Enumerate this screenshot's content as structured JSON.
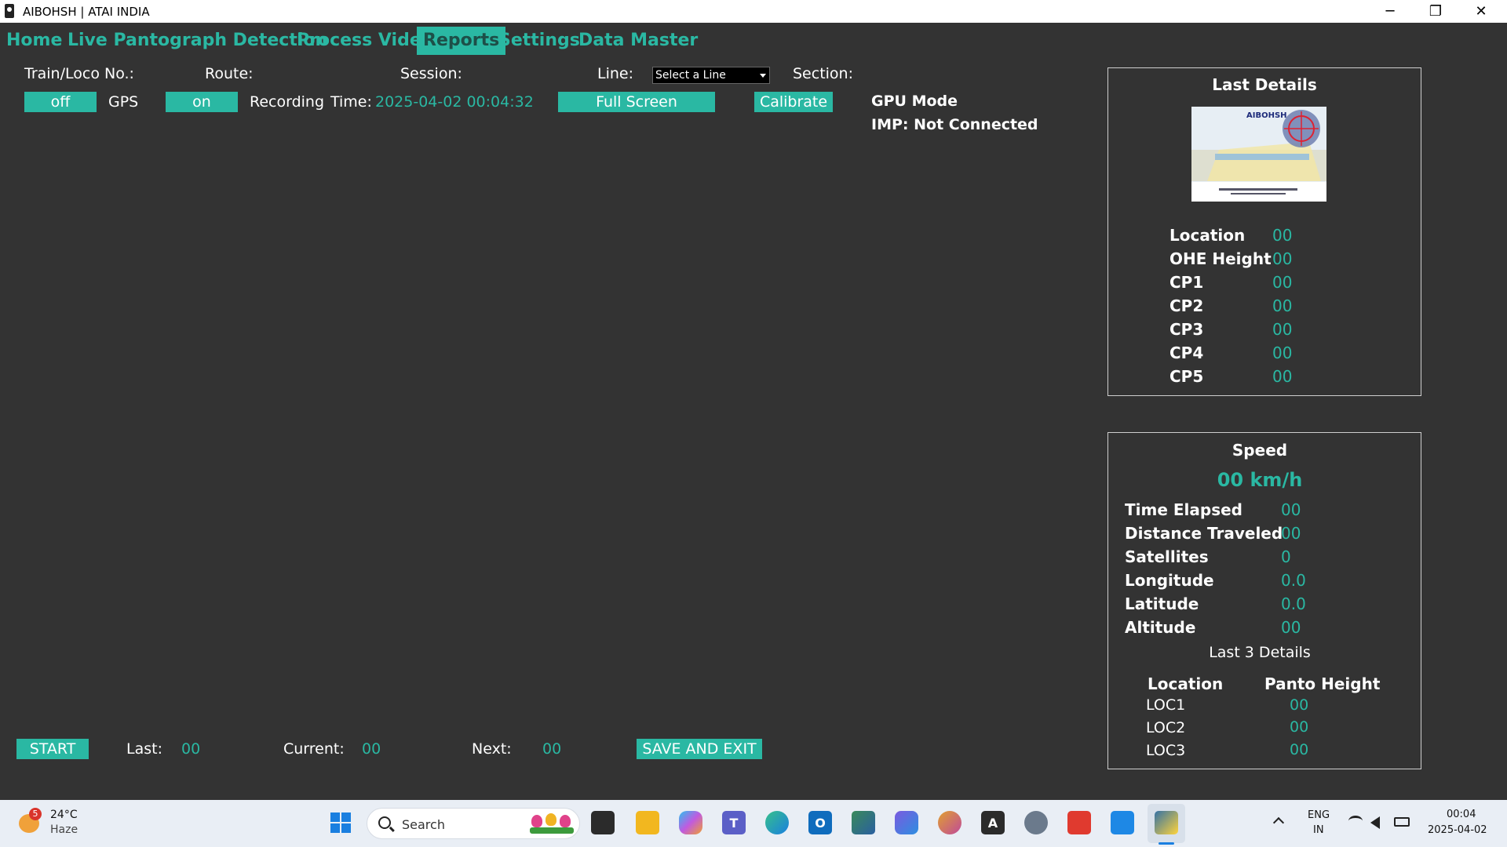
{
  "window": {
    "title": "AIBOHSH | ATAI INDIA",
    "controls": {
      "minimize": "─",
      "maximize": "❐",
      "close": "✕"
    }
  },
  "menu": {
    "items": [
      {
        "label": "Home",
        "active": false
      },
      {
        "label": "Live Pantograph Detection",
        "active": false
      },
      {
        "label": "Process Video",
        "active": false
      },
      {
        "label": "Reports",
        "active": true
      },
      {
        "label": "Settings",
        "active": false
      },
      {
        "label": "Data Master",
        "active": false
      }
    ]
  },
  "form": {
    "train_loco_label": "Train/Loco No.:",
    "route_label": "Route:",
    "session_label": "Session:",
    "line_label": "Line:",
    "line_select_value": "Select a Line",
    "section_label": "Section:"
  },
  "controls": {
    "gps_toggle": "off",
    "gps_label": "GPS",
    "recording_toggle": "on",
    "recording_label": "Recording",
    "time_label": "Time:",
    "time_value": "2025-04-02 00:04:32",
    "fullscreen_button": "Full Screen",
    "calibrate_button": "Calibrate",
    "gpu_mode": "GPU Mode",
    "imp_status": "IMP: Not Connected"
  },
  "last_details": {
    "title": "Last Details",
    "logo_text": "AIBOHSH",
    "rows": [
      {
        "label": "Location",
        "value": "00"
      },
      {
        "label": "OHE Height",
        "value": "00"
      },
      {
        "label": "CP1",
        "value": "00"
      },
      {
        "label": "CP2",
        "value": "00"
      },
      {
        "label": "CP3",
        "value": "00"
      },
      {
        "label": "CP4",
        "value": "00"
      },
      {
        "label": "CP5",
        "value": "00"
      }
    ]
  },
  "speed": {
    "title": "Speed",
    "value": "00 km/h",
    "rows": [
      {
        "label": "Time Elapsed",
        "value": "00"
      },
      {
        "label": "Distance Traveled",
        "value": "00"
      },
      {
        "label": "Satellites",
        "value": "0"
      },
      {
        "label": "Longitude",
        "value": "0.0"
      },
      {
        "label": "Latitude",
        "value": "0.0"
      },
      {
        "label": "Altitude",
        "value": "00"
      }
    ],
    "last3_title": "Last 3 Details",
    "last3_headers": {
      "location": "Location",
      "panto_height": "Panto Height"
    },
    "last3_rows": [
      {
        "location": "LOC1",
        "height": "00"
      },
      {
        "location": "LOC2",
        "height": "00"
      },
      {
        "location": "LOC3",
        "height": "00"
      }
    ]
  },
  "bottom": {
    "start_button": "START",
    "last_label": "Last:",
    "last_value": "00",
    "current_label": "Current:",
    "current_value": "00",
    "next_label": "Next:",
    "next_value": "00",
    "save_exit_button": "SAVE AND EXIT"
  },
  "taskbar": {
    "weather_badge": "5",
    "weather_temp": "24°C",
    "weather_desc": "Haze",
    "search_placeholder": "Search",
    "lang_top": "ENG",
    "lang_bottom": "IN",
    "clock_time": "00:04",
    "clock_date": "2025-04-02",
    "icons": [
      "start-icon",
      "search-icon",
      "task-view-icon",
      "file-explorer-icon",
      "copilot-icon",
      "teams-icon",
      "edge-icon",
      "outlook-icon",
      "photos-icon",
      "app-hub-icon",
      "chrome-canary-icon",
      "font-app-icon",
      "settings-icon",
      "anydesk-icon",
      "vscode-icon",
      "python-icon"
    ]
  },
  "colors": {
    "accent": "#2ab8a3",
    "background": "#333333",
    "taskbar": "#e9eef5"
  }
}
